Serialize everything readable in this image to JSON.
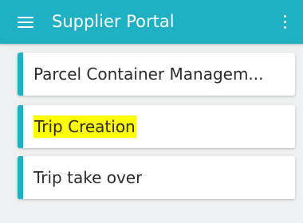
{
  "appbar": {
    "title": "Supplier Portal",
    "menu_icon": "hamburger-menu-icon",
    "more_icon": "more-vert-icon"
  },
  "colors": {
    "primary": "#1fb0c4",
    "background": "#eef0f1",
    "card": "#ffffff",
    "highlight": "#ffff00"
  },
  "menu": {
    "items": [
      {
        "label": "Parcel Container Managem...",
        "highlighted": false
      },
      {
        "label": "Trip Creation",
        "highlighted": true
      },
      {
        "label": "Trip take over",
        "highlighted": false
      }
    ]
  }
}
